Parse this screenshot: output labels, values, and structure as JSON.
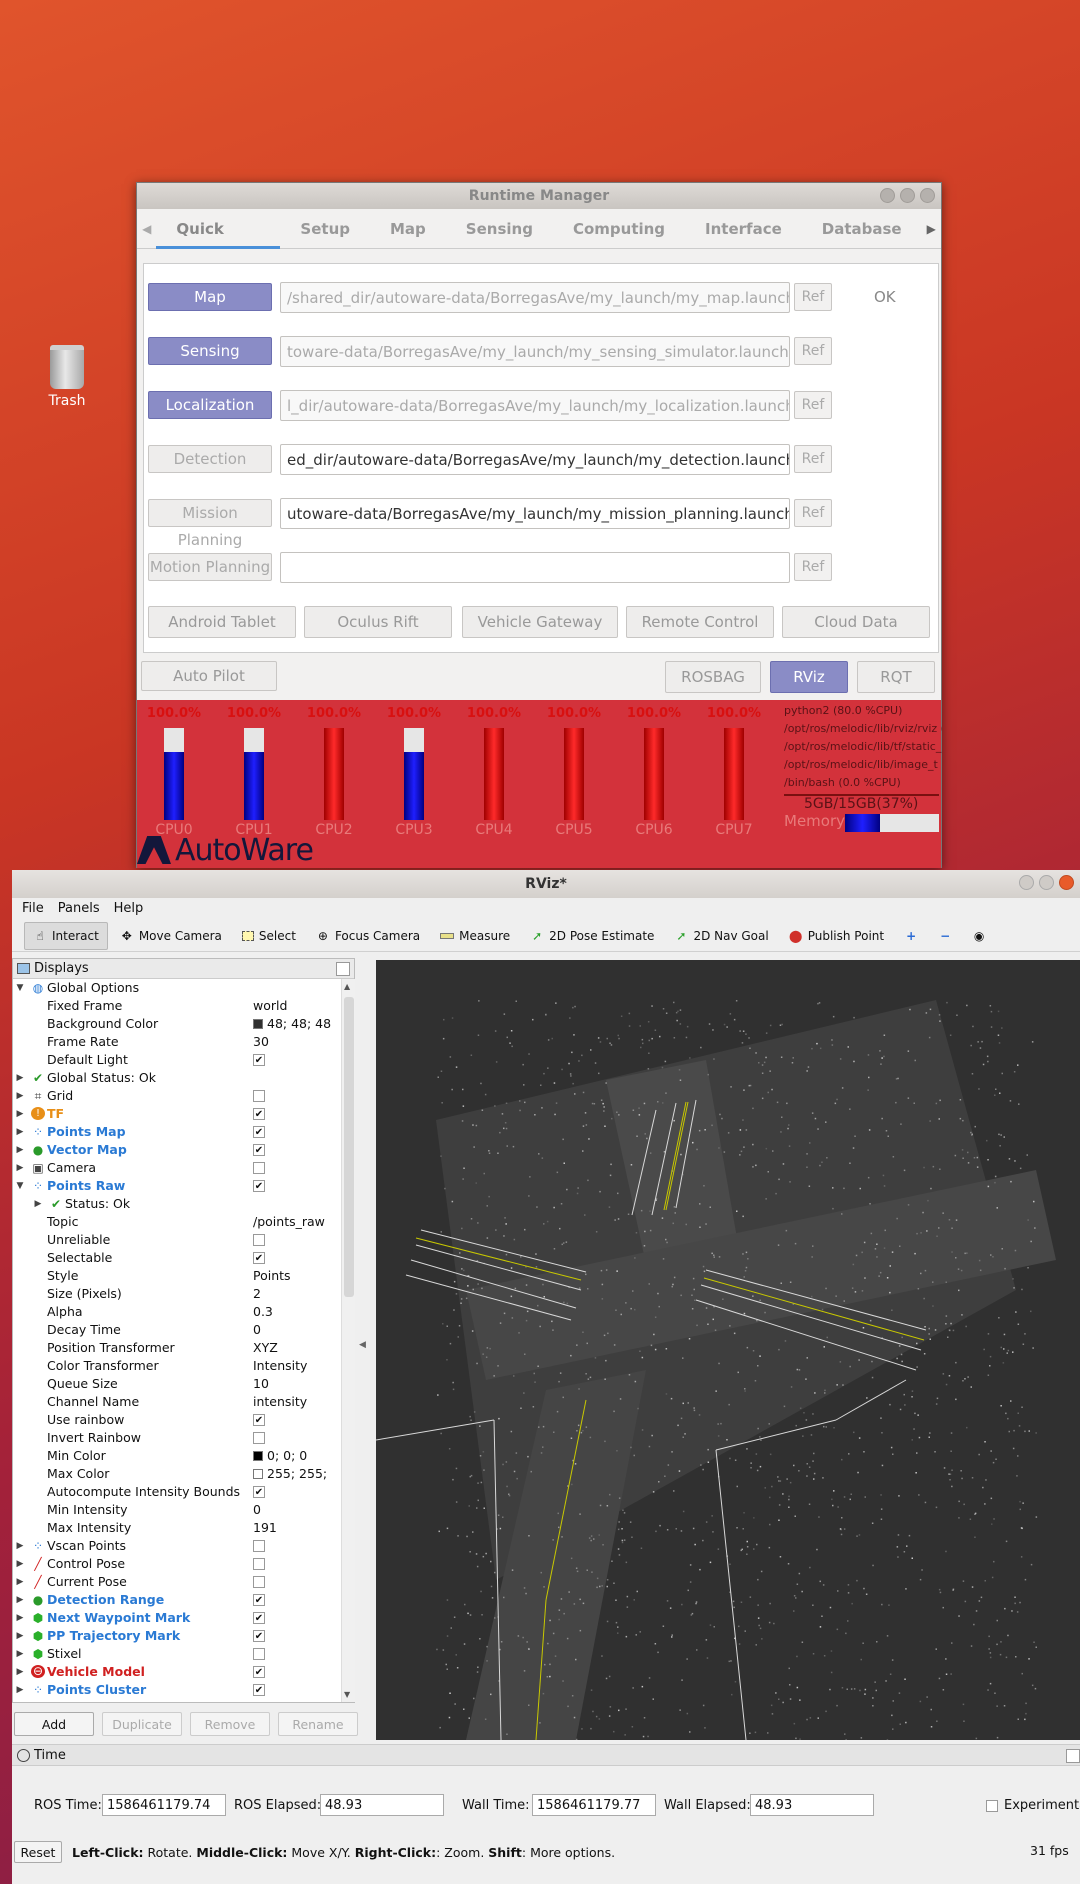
{
  "desktop": {
    "trash_label": "Trash"
  },
  "runtime_manager": {
    "title": "Runtime Manager",
    "tabs": [
      "Quick Start",
      "Setup",
      "Map",
      "Sensing",
      "Computing",
      "Interface",
      "Database"
    ],
    "launch_rows": [
      {
        "label": "Map",
        "path": "/shared_dir/autoware-data/BorregasAve/my_launch/my_map.launch",
        "ref": "Ref",
        "status": "OK"
      },
      {
        "label": "Sensing",
        "path": "toware-data/BorregasAve/my_launch/my_sensing_simulator.launch",
        "ref": "Ref",
        "status": ""
      },
      {
        "label": "Localization",
        "path": "l_dir/autoware-data/BorregasAve/my_launch/my_localization.launch",
        "ref": "Ref",
        "status": ""
      },
      {
        "label": "Detection",
        "path": "ed_dir/autoware-data/BorregasAve/my_launch/my_detection.launch",
        "ref": "Ref",
        "status": ""
      },
      {
        "label": "Mission Planning",
        "path": "utoware-data/BorregasAve/my_launch/my_mission_planning.launch",
        "ref": "Ref",
        "status": ""
      },
      {
        "label": "Motion Planning",
        "path": "",
        "ref": "Ref",
        "status": ""
      }
    ],
    "devices": [
      "Android Tablet",
      "Oculus Rift",
      "Vehicle Gateway",
      "Remote Control",
      "Cloud Data"
    ],
    "auto_pilot": "Auto Pilot",
    "tools": [
      "ROSBAG",
      "RViz",
      "RQT"
    ],
    "cpus": [
      {
        "name": "CPU0",
        "pct": "100.0%",
        "usage": 0.74
      },
      {
        "name": "CPU1",
        "pct": "100.0%",
        "usage": 0.74
      },
      {
        "name": "CPU2",
        "pct": "100.0%",
        "usage": 0.0
      },
      {
        "name": "CPU3",
        "pct": "100.0%",
        "usage": 0.74
      },
      {
        "name": "CPU4",
        "pct": "100.0%",
        "usage": 0.0
      },
      {
        "name": "CPU5",
        "pct": "100.0%",
        "usage": 0.0
      },
      {
        "name": "CPU6",
        "pct": "100.0%",
        "usage": 0.0
      },
      {
        "name": "CPU7",
        "pct": "100.0%",
        "usage": 0.0
      }
    ],
    "processes": [
      "python2 (80.0 %CPU)",
      "/opt/ros/melodic/lib/rviz/rviz (",
      "/opt/ros/melodic/lib/tf/static_",
      "/opt/ros/melodic/lib/image_t",
      "/bin/bash (0.0 %CPU)"
    ],
    "memory_text": "5GB/15GB(37%)",
    "memory_label": "Memory",
    "memory_fraction": 0.37,
    "logo_text": "AutoWare"
  },
  "rviz": {
    "title": "RViz*",
    "menu": [
      "File",
      "Panels",
      "Help"
    ],
    "tools": [
      "Interact",
      "Move Camera",
      "Select",
      "Focus Camera",
      "Measure",
      "2D Pose Estimate",
      "2D Nav Goal",
      "Publish Point"
    ],
    "displays_title": "Displays",
    "tree": [
      {
        "d": 0,
        "arrow": "open",
        "icon": "globe",
        "name": "Global Options"
      },
      {
        "d": 1,
        "name": "Fixed Frame",
        "val": "world"
      },
      {
        "d": 1,
        "name": "Background Color",
        "val": "48; 48; 48",
        "swatch": "#303030"
      },
      {
        "d": 1,
        "name": "Frame Rate",
        "val": "30"
      },
      {
        "d": 1,
        "name": "Default Light",
        "chk": true
      },
      {
        "d": 0,
        "arrow": "closed",
        "icon": "ok",
        "name": "Global Status: Ok"
      },
      {
        "d": 0,
        "arrow": "closed",
        "icon": "grid",
        "name": "Grid",
        "chk": false
      },
      {
        "d": 0,
        "arrow": "closed",
        "icon": "warn",
        "name": "TF",
        "style": "orange",
        "chk": true
      },
      {
        "d": 0,
        "arrow": "closed",
        "icon": "points",
        "name": "Points Map",
        "style": "blue",
        "chk": true
      },
      {
        "d": 0,
        "arrow": "closed",
        "icon": "marker",
        "name": "Vector Map",
        "style": "blue",
        "chk": true
      },
      {
        "d": 0,
        "arrow": "closed",
        "icon": "camera",
        "name": "Camera",
        "chk": false
      },
      {
        "d": 0,
        "arrow": "open",
        "icon": "points",
        "name": "Points Raw",
        "style": "blue",
        "chk": true
      },
      {
        "d": 1,
        "arrow": "closed",
        "icon": "ok",
        "name": "Status: Ok"
      },
      {
        "d": 1,
        "name": "Topic",
        "val": "/points_raw"
      },
      {
        "d": 1,
        "name": "Unreliable",
        "chk": false
      },
      {
        "d": 1,
        "name": "Selectable",
        "chk": true
      },
      {
        "d": 1,
        "name": "Style",
        "val": "Points"
      },
      {
        "d": 1,
        "name": "Size (Pixels)",
        "val": "2"
      },
      {
        "d": 1,
        "name": "Alpha",
        "val": "0.3"
      },
      {
        "d": 1,
        "name": "Decay Time",
        "val": "0"
      },
      {
        "d": 1,
        "name": "Position Transformer",
        "val": "XYZ"
      },
      {
        "d": 1,
        "name": "Color Transformer",
        "val": "Intensity"
      },
      {
        "d": 1,
        "name": "Queue Size",
        "val": "10"
      },
      {
        "d": 1,
        "name": "Channel Name",
        "val": "intensity"
      },
      {
        "d": 1,
        "name": "Use rainbow",
        "chk": true
      },
      {
        "d": 1,
        "name": "Invert Rainbow",
        "chk": false
      },
      {
        "d": 1,
        "name": "Min Color",
        "val": "0; 0; 0",
        "swatch": "#000000"
      },
      {
        "d": 1,
        "name": "Max Color",
        "val": "255; 255;",
        "swatch": "#ffffff"
      },
      {
        "d": 1,
        "name": "Autocompute Intensity Bounds",
        "chk": true
      },
      {
        "d": 1,
        "name": "Min Intensity",
        "val": "0"
      },
      {
        "d": 1,
        "name": "Max Intensity",
        "val": "191"
      },
      {
        "d": 0,
        "arrow": "closed",
        "icon": "points",
        "name": "Vscan Points",
        "chk": false
      },
      {
        "d": 0,
        "arrow": "closed",
        "icon": "pose",
        "name": "Control Pose",
        "chk": false
      },
      {
        "d": 0,
        "arrow": "closed",
        "icon": "pose",
        "name": "Current Pose",
        "chk": false
      },
      {
        "d": 0,
        "arrow": "closed",
        "icon": "marker",
        "name": "Detection Range",
        "style": "blue",
        "chk": true
      },
      {
        "d": 0,
        "arrow": "closed",
        "icon": "cube",
        "name": "Next Waypoint Mark",
        "style": "blue",
        "chk": true
      },
      {
        "d": 0,
        "arrow": "closed",
        "icon": "cube",
        "name": "PP Trajectory Mark",
        "style": "blue",
        "chk": true
      },
      {
        "d": 0,
        "arrow": "closed",
        "icon": "cube",
        "name": "Stixel",
        "chk": false
      },
      {
        "d": 0,
        "arrow": "closed",
        "icon": "error",
        "name": "Vehicle Model",
        "style": "red",
        "chk": true
      },
      {
        "d": 0,
        "arrow": "closed",
        "icon": "points",
        "name": "Points Cluster",
        "style": "blue",
        "chk": true
      }
    ],
    "panel_buttons": [
      "Add",
      "Duplicate",
      "Remove",
      "Rename"
    ],
    "time_title": "Time",
    "ros_time_label": "ROS Time:",
    "ros_time": "1586461179.74",
    "ros_elapsed_label": "ROS Elapsed:",
    "ros_elapsed": "48.93",
    "wall_time_label": "Wall Time:",
    "wall_time": "1586461179.77",
    "wall_elapsed_label": "Wall Elapsed:",
    "wall_elapsed": "48.93",
    "experimental_label": "Experimental",
    "reset_label": "Reset",
    "hint_left_key": "Left-Click:",
    "hint_left": " Rotate. ",
    "hint_mid_key": "Middle-Click:",
    "hint_mid": " Move X/Y. ",
    "hint_right_key": "Right-Click:",
    "hint_right": ": Zoom. ",
    "hint_shift_key": "Shift",
    "hint_shift": ": More options.",
    "fps": "31 fps"
  },
  "colors": {
    "background": "#303030",
    "lane": "#c8c800",
    "accent": "#8a8cc6"
  }
}
